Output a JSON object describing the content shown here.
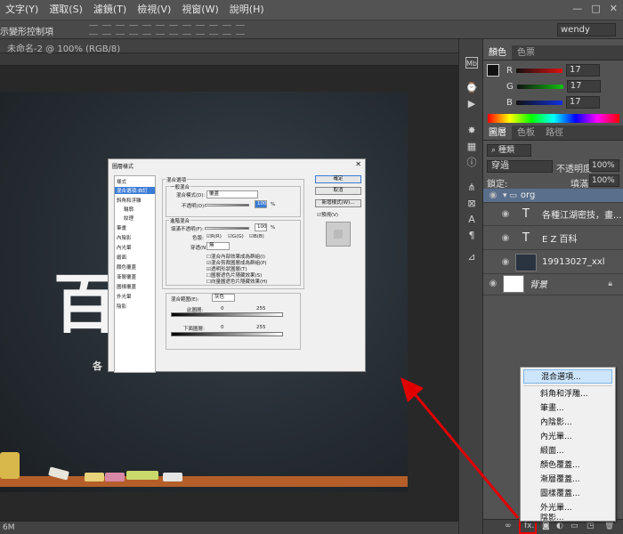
{
  "menubar": {
    "items": [
      "文字(Y)",
      "選取(S)",
      "濾鏡(T)",
      "檢視(V)",
      "視窗(W)",
      "說明(H)"
    ],
    "window_controls": [
      "—",
      "□",
      "✕"
    ]
  },
  "options_bar": {
    "label": "示變形控制項",
    "workspace": "wendy"
  },
  "document": {
    "tab_title": "未命名-2 @ 100% (RGB/8)",
    "status_zoom": "6M"
  },
  "artwork": {
    "big_text": "百",
    "sub_text": "各"
  },
  "color_panel": {
    "tabs": [
      "顏色",
      "色票"
    ],
    "rows": [
      {
        "label": "R",
        "value": "17",
        "color": "#d02020"
      },
      {
        "label": "G",
        "value": "17",
        "color": "#20b020"
      },
      {
        "label": "B",
        "value": "17",
        "color": "#2040d0"
      }
    ]
  },
  "layers_panel": {
    "tabs": [
      "圖層",
      "色板",
      "路徑"
    ],
    "kind": "種類",
    "blend_mode": "穿過",
    "opacity_label": "不透明度:",
    "opacity": "100%",
    "lock_label": "鎖定:",
    "fill_label": "填滿:",
    "fill": "100%",
    "layers": [
      {
        "name": "org",
        "type": "group"
      },
      {
        "name": "各種江湖密技，畫...",
        "type": "text"
      },
      {
        "name": "E Z 百科",
        "type": "text"
      },
      {
        "name": "19913027_xxl",
        "type": "image"
      },
      {
        "name": "背景",
        "type": "background"
      }
    ]
  },
  "dialog": {
    "title": "圖層樣式",
    "styles_header": "樣式",
    "style_items": [
      "混合選項:自訂",
      "斜角和浮雕",
      "輪廓",
      "紋理",
      "筆畫",
      "內陰影",
      "內光暈",
      "緞面",
      "顏色覆蓋",
      "漸層覆蓋",
      "圖樣覆蓋",
      "外光暈",
      "陰影"
    ],
    "group_blend": "混合選項",
    "general": "一般混合",
    "blend_mode_label": "混合模式(D):",
    "blend_mode": "覆蓋",
    "opacity_label": "不透明(O):",
    "opacity": "100",
    "advanced": "進階混合",
    "fill_opacity_label": "填滿不透明(F):",
    "fill_opacity": "100",
    "channels_label": "色版:",
    "channels": [
      "R(R)",
      "G(G)",
      "B(B)"
    ],
    "knockout_label": "穿透(N):",
    "knockout": "無",
    "options": [
      "混合內部效果成為群組(I)",
      "混合剪裁圖層成為群組(P)",
      "透明形狀圖層(T)",
      "圖層遮色片隱藏效果(S)",
      "向量圖遮色片隱藏效果(H)"
    ],
    "blend_if_label": "混合範圍(E):",
    "blend_if": "灰色",
    "this_layer": "此圖層:",
    "underlying": "下面圖層:",
    "range_min": "0",
    "range_max": "255",
    "buttons": [
      "確定",
      "取消",
      "新增樣式(W)..."
    ],
    "preview_label": "預視(V)"
  },
  "context_menu": {
    "items": [
      "混合選項...",
      "斜角和浮雕...",
      "筆畫...",
      "內陰影...",
      "內光暈...",
      "緞面...",
      "顏色覆蓋...",
      "漸層覆蓋...",
      "圖樣覆蓋...",
      "外光暈...",
      "陰影..."
    ]
  },
  "layers_bottom": {
    "fx_label": "fx."
  },
  "colors": {
    "arrow": "#e00000",
    "highlight": "#cde5fa",
    "selected_layer": "#5a6f8c"
  }
}
